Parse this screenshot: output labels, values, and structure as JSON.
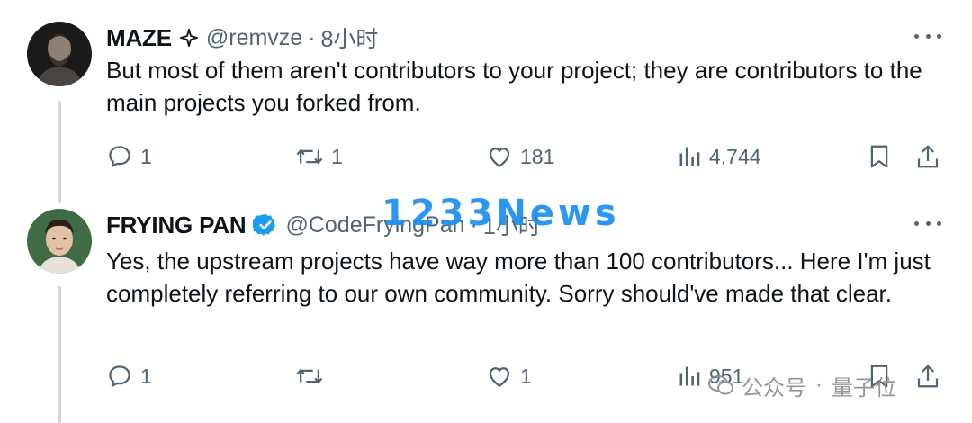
{
  "tweets": [
    {
      "name": "MAZE",
      "badge_icon": "sparkle-icon",
      "handle": "@remvze",
      "separator": "·",
      "time": "8小时",
      "text": "But most of them aren't contributors to your project; they are contributors to the main projects you forked from.",
      "actions": {
        "replies": "1",
        "reposts": "1",
        "likes": "181",
        "views": "4,744"
      }
    },
    {
      "name": "FRYING PAN",
      "badge_icon": "verified-badge-icon",
      "badge_color": "#1d9bf0",
      "handle": "@CodeFryingPan",
      "separator": "·",
      "time": "1小时",
      "text": "Yes, the upstream projects have way more than 100 contributors... Here I'm just completely referring to our own community. Sorry should've made that clear.",
      "actions": {
        "replies": "1",
        "reposts": "",
        "likes": "1",
        "views": "951"
      }
    }
  ],
  "watermarks": {
    "top": "1233News",
    "bottom_left": "公众号",
    "bottom_sep": "·",
    "bottom_right": "量子位"
  },
  "colors": {
    "text": "#0f1419",
    "secondary": "#536471",
    "verified": "#1d9bf0",
    "thread_line": "#cfd9de",
    "watermark_blue": "#1b8ef2"
  }
}
